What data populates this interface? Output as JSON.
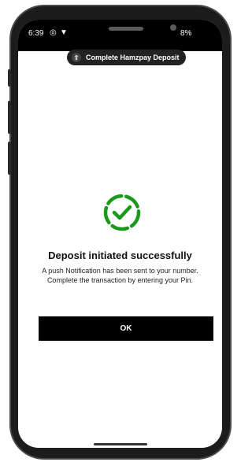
{
  "status": {
    "time": "6:39",
    "battery": "8%"
  },
  "notification": {
    "label": "Complete Hamzpay Deposit"
  },
  "dialog": {
    "title": "Deposit initiated successfully",
    "message_line1": "A push Notification has been sent to your number.",
    "message_line2": "Complete the transaction by entering your Pin.",
    "ok_label": "OK",
    "icon": "check-circle-dashed-icon",
    "accent_color": "#1a9a1a"
  },
  "colors": {
    "button_bg": "#000000",
    "text": "#111111"
  }
}
